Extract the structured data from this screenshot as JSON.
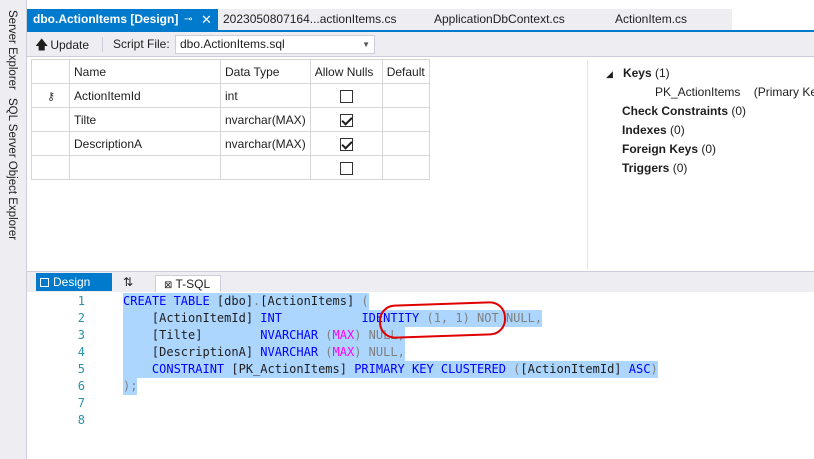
{
  "side_tabs": [
    "Server Explorer",
    "SQL Server Object Explorer"
  ],
  "tabs": [
    {
      "label": "dbo.ActionItems [Design]",
      "active": true
    },
    {
      "label": "2023050807164...actionItems.cs",
      "active": false
    },
    {
      "label": "ApplicationDbContext.cs",
      "active": false
    },
    {
      "label": "ActionItem.cs",
      "active": false
    }
  ],
  "toolbar": {
    "update_label": "Update",
    "script_file_label": "Script File:",
    "script_file_value": "dbo.ActionItems.sql"
  },
  "grid": {
    "columns": [
      "Name",
      "Data Type",
      "Allow Nulls",
      "Default"
    ],
    "rows": [
      {
        "name": "ActionItemId",
        "type": "int",
        "nulls": false,
        "default": "",
        "key": true
      },
      {
        "name": "Tilte",
        "type": "nvarchar(MAX)",
        "nulls": true,
        "default": "",
        "key": false
      },
      {
        "name": "DescriptionA",
        "type": "nvarchar(MAX)",
        "nulls": true,
        "default": "",
        "key": false
      },
      {
        "name": "",
        "type": "",
        "nulls": false,
        "default": "",
        "key": false
      }
    ]
  },
  "props": {
    "keys_label": "Keys",
    "keys_count": "(1)",
    "pk_name": "PK_ActionItems",
    "pk_desc": "(Primary Key, C",
    "check_label": "Check Constraints",
    "check_count": "(0)",
    "indexes_label": "Indexes",
    "indexes_count": "(0)",
    "fk_label": "Foreign Keys",
    "fk_count": "(0)",
    "triggers_label": "Triggers",
    "triggers_count": "(0)"
  },
  "pane_tabs": {
    "design": "Design",
    "swap": "⇅",
    "tsql": "T-SQL"
  },
  "code": {
    "line_numbers": [
      "1",
      "2",
      "3",
      "4",
      "5",
      "6",
      "7",
      "8"
    ],
    "l1": {
      "a": "CREATE TABLE ",
      "b": "[dbo]",
      "c": ".",
      "d": "[ActionItems]",
      "e": " ("
    },
    "l2": {
      "a": "    [ActionItemId] ",
      "b": "INT",
      "c": "           ",
      "d": "IDENTITY",
      "e": " (1, 1)",
      "f": " NOT NULL,"
    },
    "l3": {
      "a": "    [Tilte]        ",
      "b": "NVARCHAR",
      "c": " (",
      "d": "MAX",
      "e": ")",
      "f": " NULL,"
    },
    "l4": {
      "a": "    [DescriptionA] ",
      "b": "NVARCHAR",
      "c": " (",
      "d": "MAX",
      "e": ")",
      "f": " NULL,"
    },
    "l5": {
      "a": "    ",
      "b": "CONSTRAINT",
      "c": " [PK_ActionItems] ",
      "d": "PRIMARY KEY CLUSTERED",
      "e": " (",
      "f": "[ActionItemId]",
      "g": " ",
      "h": "ASC",
      "i": ")"
    },
    "l6": {
      "a": ");"
    }
  }
}
